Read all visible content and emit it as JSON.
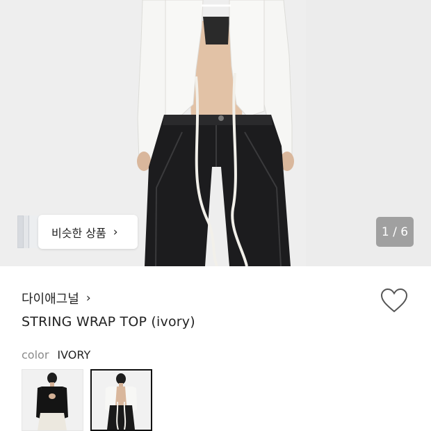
{
  "similar": {
    "label": "비슷한 상품",
    "chevron": "›"
  },
  "pager": {
    "text": "1 / 6"
  },
  "product": {
    "brand": "다이애그널",
    "brand_chevron": "›",
    "title": "STRING WRAP TOP (ivory)",
    "color_label": "color",
    "color_value": "IVORY"
  },
  "swatches": [
    {
      "name": "black-variant",
      "selected": false
    },
    {
      "name": "ivory-variant",
      "selected": true
    }
  ],
  "icons": {
    "wishlist": "heart-icon"
  },
  "colors": {
    "pager_bg": "#6e6e6e",
    "text": "#222222",
    "muted": "#8a8a8a"
  }
}
